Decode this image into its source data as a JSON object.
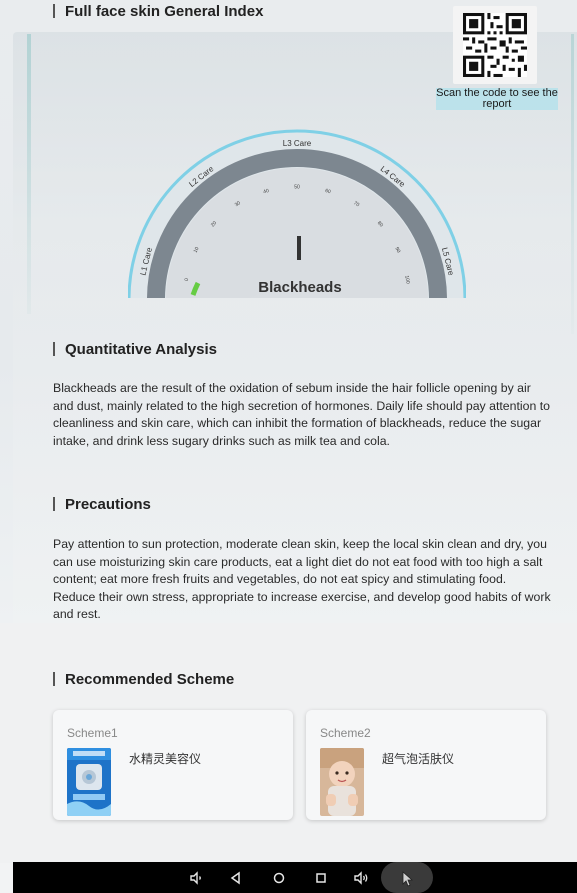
{
  "header": {
    "title": "Full face skin General Index"
  },
  "qr": {
    "caption": "Scan the code to see the report"
  },
  "gauge": {
    "zones": [
      "L1 Care",
      "L2 Care",
      "L3 Care",
      "L4 Care",
      "L5 Care"
    ],
    "ticks": [
      "0",
      "10",
      "20",
      "30",
      "40",
      "50",
      "60",
      "70",
      "80",
      "90",
      "100"
    ],
    "value_text": "I",
    "indicator": "Blackheads",
    "arc_color": "#7fd0e6",
    "track_color": "#7d8790"
  },
  "quantitative": {
    "title": "Quantitative Analysis",
    "text": "Blackheads are the result of the oxidation of sebum inside the hair follicle opening by air and dust, mainly related to the high secretion of hormones. Daily life should pay attention to cleanliness and skin care, which can inhibit the formation of blackheads, reduce the sugar intake, and drink less sugary drinks such as milk tea and cola."
  },
  "precautions": {
    "title": "Precautions",
    "text": "Pay attention to sun protection, moderate clean skin, keep the local skin clean and dry, you can use moisturizing skin care products, eat a light diet do not eat food with too high a salt content; eat more fresh fruits and vegetables, do not eat spicy and stimulating food. Reduce their own stress, appropriate to increase exercise, and develop good habits of work and rest."
  },
  "recommended": {
    "title": "Recommended Scheme",
    "schemes": [
      {
        "label": "Scheme1",
        "product": "水精灵美容仪"
      },
      {
        "label": "Scheme2",
        "product": "超气泡活肤仪"
      }
    ]
  },
  "navbar": {
    "icons": [
      "volume-down-icon",
      "back-icon",
      "home-icon",
      "recents-icon",
      "volume-up-icon",
      "screenshot-icon"
    ]
  }
}
